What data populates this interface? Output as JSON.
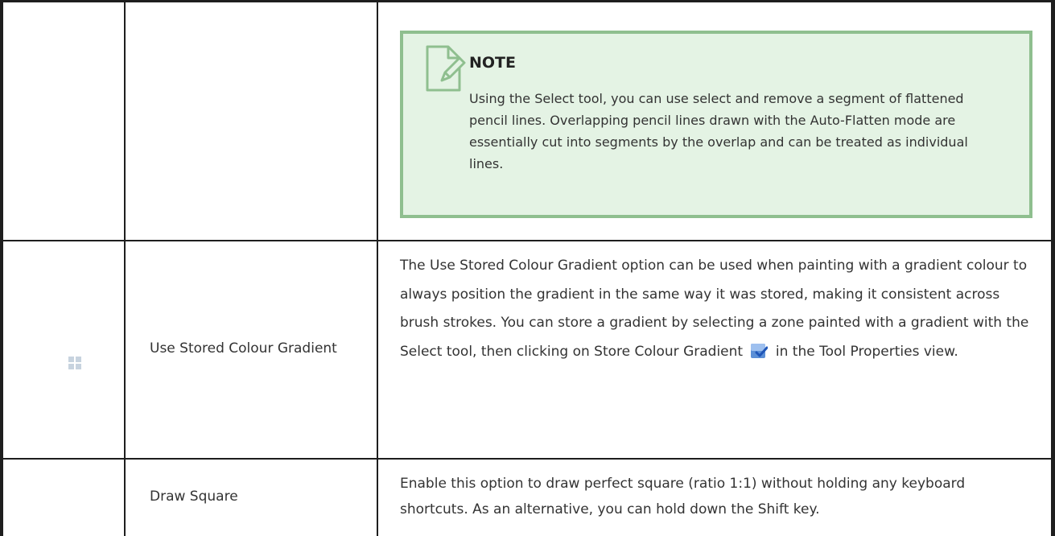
{
  "note": {
    "title": "NOTE",
    "body": "Using the Select tool, you can use select and remove a segment of flattened pencil lines. Overlapping pencil lines drawn with the Auto-Flatten mode are essentially cut into segments by the overlap and can be treated as individual lines.",
    "icon": "note-pencil-icon"
  },
  "rows": [
    {
      "name": "Use Stored Colour Gradient",
      "icon": "grid-icon",
      "description_before": "The Use Stored Colour Gradient option can be used when painting with a gradient colour to always position the gradient in the same way it was stored, making it consistent across brush strokes. You can store a gradient by selecting a zone painted with a gradient with the Select tool, then clicking on Store Colour Gradient",
      "description_after": "in the Tool Properties view.",
      "inline_icon": "store-colour-gradient-icon"
    },
    {
      "name": "Draw Square",
      "description": "Enable this option to draw perfect square (ratio 1:1) without holding any keyboard shortcuts. As an alternative, you can hold down the Shift key."
    }
  ],
  "colors": {
    "note_background": "#e4f3e4",
    "note_border": "#8fbf8f",
    "border": "#1e1e1e"
  }
}
